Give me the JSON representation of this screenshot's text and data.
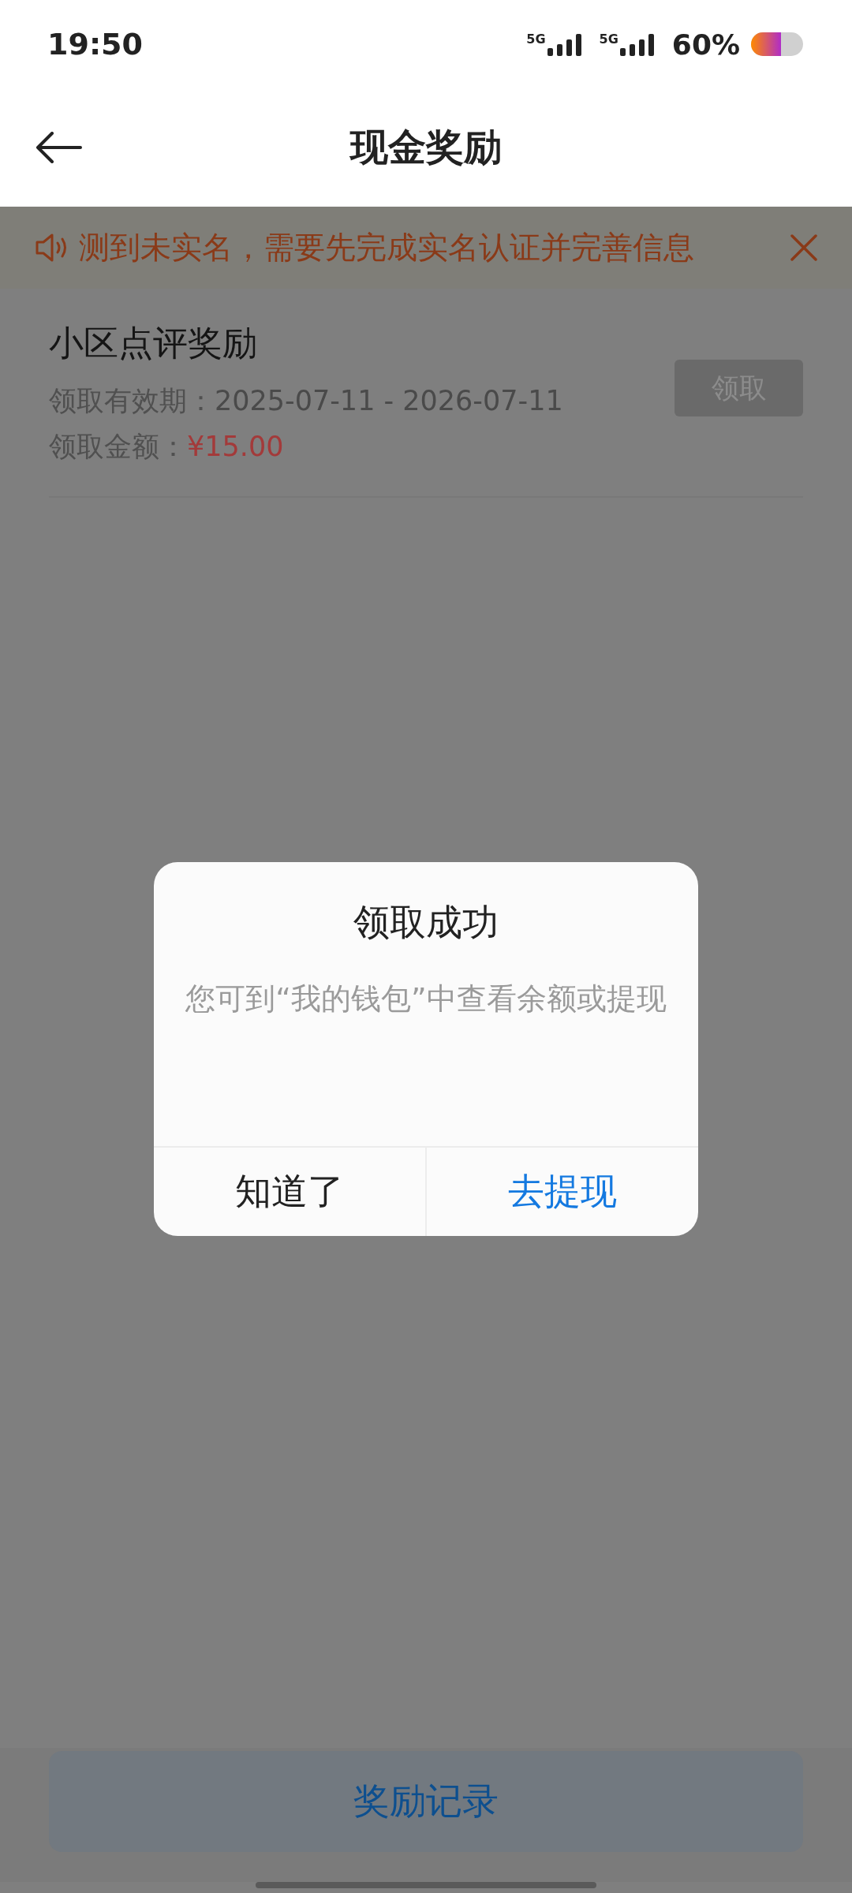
{
  "status_bar": {
    "time": "19:50",
    "signals": [
      "5G",
      "5G"
    ],
    "battery": "60%"
  },
  "header": {
    "title": "现金奖励"
  },
  "notice": {
    "text": "测到未实名，需要先完成实名认证并完善信息"
  },
  "rewards": [
    {
      "title": "小区点评奖励",
      "validity_label": "领取有效期：",
      "validity": "2025-07-11 - 2026-07-11",
      "amount_label": "领取金额：",
      "amount": "¥15.00",
      "button": "领取",
      "disabled": true
    }
  ],
  "dialog": {
    "title": "领取成功",
    "message": "您可到“我的钱包”中查看余额或提现",
    "buttons": [
      {
        "label": "知道了",
        "kind": "secondary"
      },
      {
        "label": "去提现",
        "kind": "primary"
      }
    ]
  },
  "footer_button": "奖励记录"
}
